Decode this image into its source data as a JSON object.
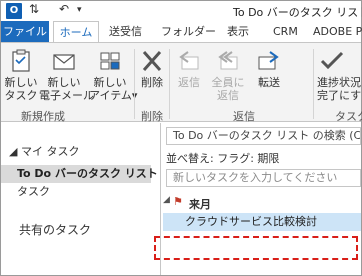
{
  "window": {
    "title": "To Do バーのタスク リスト - "
  },
  "tabs": {
    "file": "ファイル",
    "home": "ホーム",
    "send_receive": "送受信",
    "folder": "フォルダー",
    "view": "表示",
    "crm": "CRM",
    "adobe": "ADOBE P"
  },
  "ribbon": {
    "new_task": "新しい\nタスク",
    "new_email": "新しい\n電子メール",
    "new_items": "新しい\nアイテム▾",
    "delete": "削除",
    "reply": "返信",
    "reply_all": "全員に\n返信",
    "forward": "転送",
    "progress": "進捗状況\n完了にす",
    "groups": {
      "new": "新規作成",
      "delete": "削除",
      "respond": "返信",
      "task": "タスク"
    }
  },
  "nav": {
    "section": "◢ マイ タスク",
    "items": [
      "To Do バーのタスク リスト",
      "タスク"
    ],
    "shared": "共有のタスク"
  },
  "main": {
    "search_placeholder": "To Do バーのタスク リスト の検索 (Ctrl+E)",
    "sort": "並べ替え: フラグ: 期限",
    "new_task_placeholder": "新しいタスクを入力してください",
    "group_label": "来月",
    "task": "クラウドサービス比較検討"
  },
  "colors": {
    "accent": "#1c6bbd",
    "selection": "#cde4f7",
    "highlight_box": "#d91e18"
  }
}
